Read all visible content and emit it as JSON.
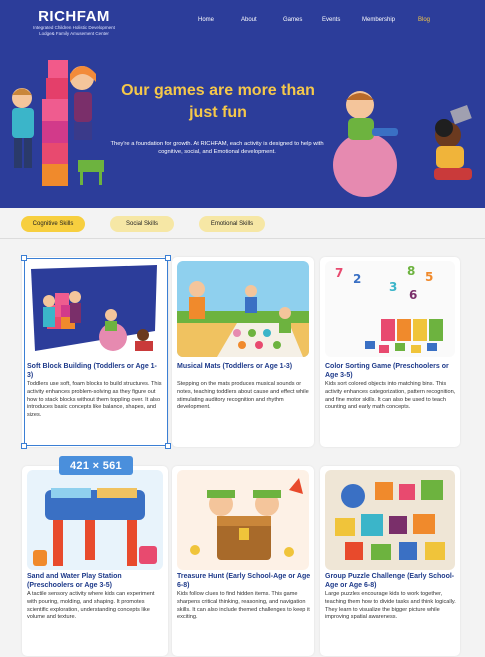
{
  "header": {
    "logo_title": "RICHFAM",
    "logo_subtitle": "Integrated Children Holistic Development Lodge& Family Amusement Center",
    "nav": [
      "Home",
      "About",
      "Games",
      "Events",
      "Membership",
      "Blog"
    ],
    "active_nav": "Blog"
  },
  "hero": {
    "headline_line1": "Our games are more than",
    "headline_line2": "just fun",
    "subtext": "They're a foundation for growth. At RICHFAM, each activity is designed to help with cognitive, social, and Emotional development."
  },
  "tabs": [
    {
      "label": "Cognitive Skills",
      "active": true
    },
    {
      "label": "Social Skills",
      "active": false
    },
    {
      "label": "Emotional Skills",
      "active": false
    }
  ],
  "cards": [
    {
      "title": "Soft Block Building (Toddlers or Age 1-3)",
      "desc": "Toddlers use soft, foam blocks to build structures. This activity enhances problem-solving as they figure out how to stack blocks without them toppling over. It also introduces basic concepts like balance, shapes, and sizes.",
      "image": "soft-blocks-illustration"
    },
    {
      "title": "Musical Mats (Toddlers  or Age 1-3)",
      "desc": "Stepping on the mats produces musical sounds or notes, teaching toddlers about cause and effect while stimulating auditory recognition and rhythm development.",
      "image": "musical-mats-illustration"
    },
    {
      "title": "Color Sorting Game (Preschoolers  or Age 3-5)",
      "desc": "Kids sort colored objects into matching bins. This activity enhances categorization, pattern recognition, and fine motor skills. It can also be used to teach counting and early math concepts.",
      "image": "color-sorting-photo"
    },
    {
      "title": "Sand and Water Play Station (Preschoolers or Age 3-5)",
      "desc": "A tactile sensory activity where kids can experiment with pouring, molding, and shaping. It promotes scientific exploration, understanding concepts like volume and texture.",
      "image": "sand-water-table-photo"
    },
    {
      "title": "Treasure Hunt (Early School-Age or Age 6-8)",
      "desc": "Kids follow clues to find hidden items. This game sharpens critical thinking, reasoning, and navigation skills. It can also include themed challenges to keep it exciting.",
      "image": "treasure-hunt-illustration"
    },
    {
      "title": "Group Puzzle Challenge (Early School-Age or Age 6-8)",
      "desc": "Large puzzles encourage kids to work together, teaching them how to divide tasks and think logically. They learn to visualize the bigger picture while improving spatial awareness.",
      "image": "puzzle-pieces-photo"
    }
  ],
  "selection": {
    "dimensions_label": "421 × 561"
  },
  "colors": {
    "hero_bg": "#2c3d9a",
    "accent_yellow": "#f5c84a",
    "title_blue": "#1e3a8a",
    "selection_blue": "#3b7fd4"
  }
}
